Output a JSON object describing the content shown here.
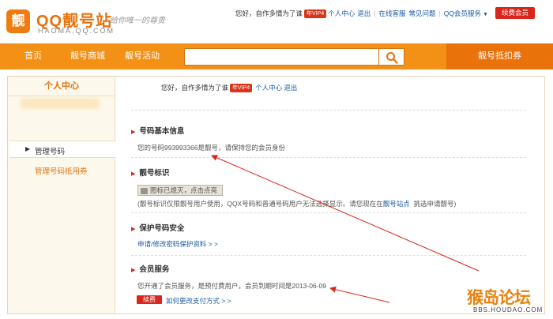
{
  "logo": {
    "badge": "靓",
    "title": "QQ靓号站",
    "domain": "HAOMA.QQ.COM",
    "slogan": "给你唯一的尊贵"
  },
  "topnav": {
    "greeting": "您好，自作多情为了谁",
    "vip_badge": "年VIP4",
    "personal_center": "个人中心",
    "logout": "退出",
    "customer_service": "在线客服",
    "faq": "常见问题",
    "member_service": "QQ会员服务",
    "renew": "续费会员"
  },
  "navbar": {
    "home": "首页",
    "mall": "靓号商城",
    "events": "靓号活动",
    "search_value": "",
    "discount": "靓号抵扣券"
  },
  "sidebar": {
    "title": "个人中心",
    "items": [
      {
        "label": "管理号码",
        "active": true
      },
      {
        "label": "管理号码抵用券",
        "active": false
      }
    ]
  },
  "content": {
    "welcome": {
      "greeting": "您好，自作多情为了谁",
      "vip_badge": "年VIP4",
      "personal_center": "个人中心",
      "logout": "退出"
    },
    "basic_info": {
      "title": "号码基本信息",
      "text": "您的号码993993366是靓号，请保持您的会员身份"
    },
    "mark": {
      "title": "靓号标识",
      "button": "图标已熄灭，点击点亮",
      "note_prefix": "(靓号标识仅限靓号用户使用，QQX号码和普通号码用户无法选择显示。请您现在在",
      "note_link": "靓号站点",
      "note_suffix": "挑选申请靓号)"
    },
    "security": {
      "title": "保护号码安全",
      "link": "申请/修改密码保护资料 > >"
    },
    "member": {
      "title": "会员服务",
      "text": "您开通了会员服务，是预付费用户，会员到期时间是2013-06-09",
      "renew_button": "续费",
      "payment_link": "如何更改支付方式 > >"
    }
  },
  "watermark": {
    "main": "猴岛论坛",
    "sub": "BBS.HOUDAO.COM"
  },
  "colors": {
    "brand_orange": "#f39016",
    "accent_red": "#d9261c",
    "link_blue": "#1b5aa3"
  }
}
